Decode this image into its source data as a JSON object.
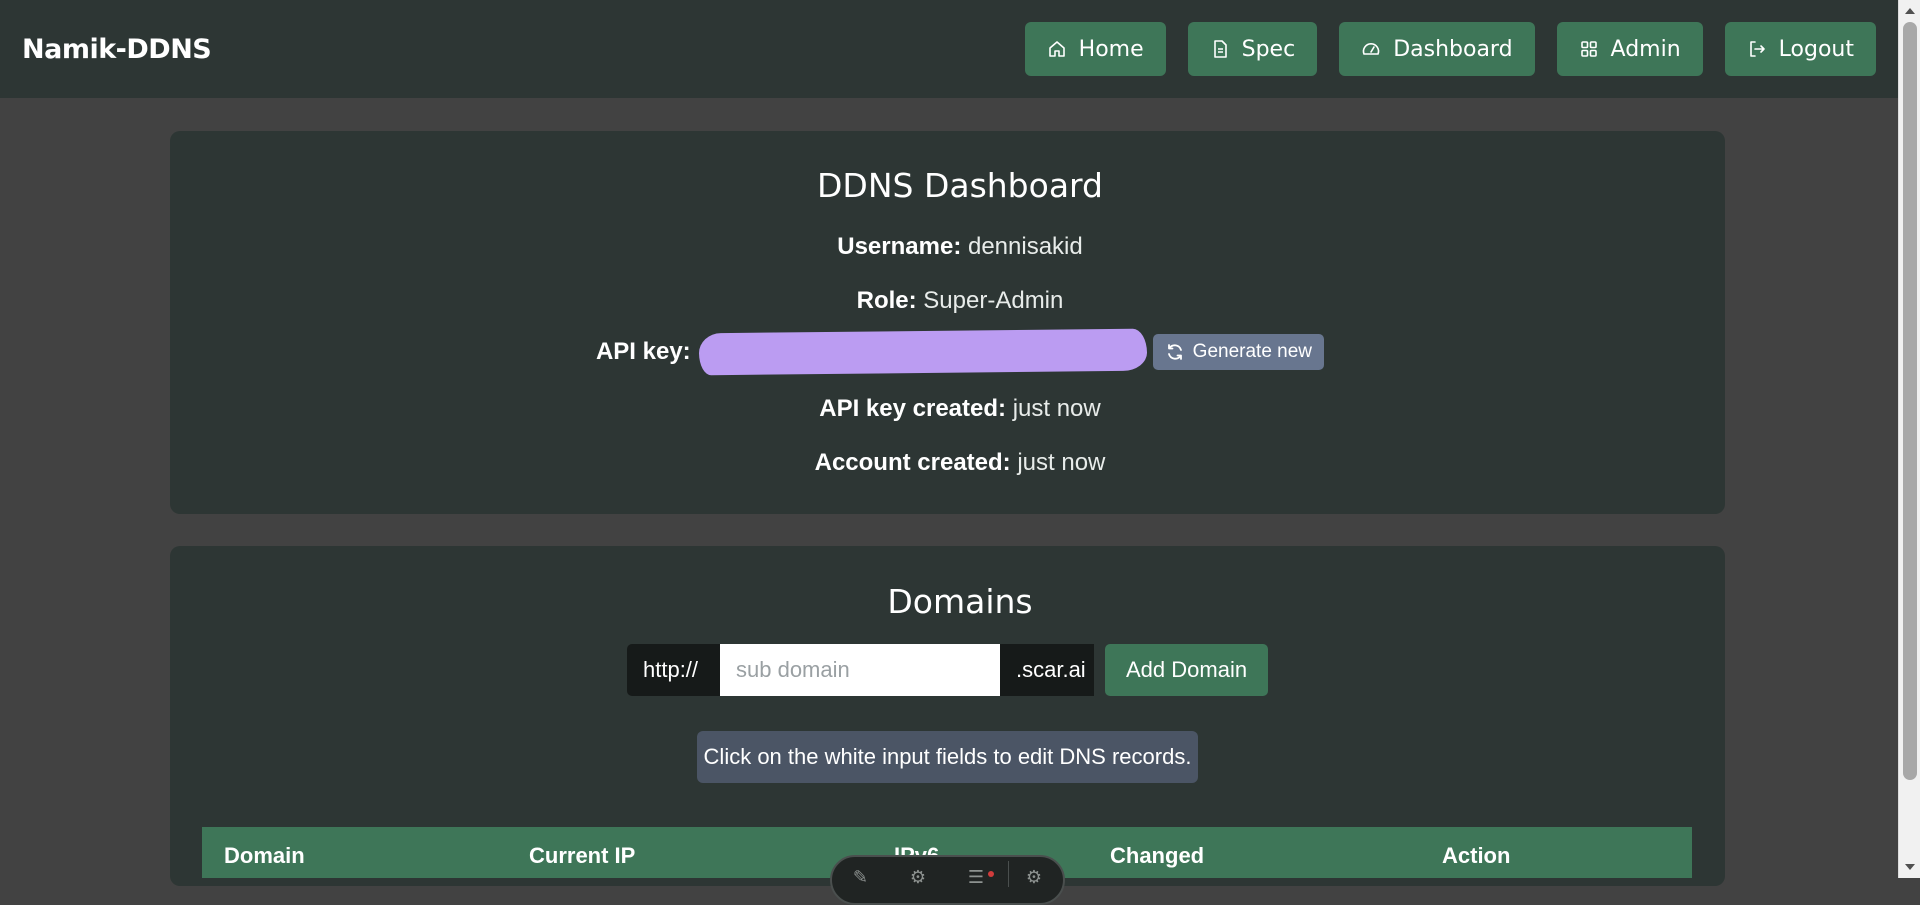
{
  "brand": "Namik-DDNS",
  "nav": {
    "home": "Home",
    "spec": "Spec",
    "dashboard": "Dashboard",
    "admin": "Admin",
    "logout": "Logout"
  },
  "dashboard": {
    "title": "DDNS Dashboard",
    "username_label": "Username:",
    "username_value": "dennisakid",
    "role_label": "Role:",
    "role_value": "Super-Admin",
    "api_key_label": "API key:",
    "generate_label": "Generate new",
    "api_created_label": "API key created:",
    "api_created_value": "just now",
    "account_created_label": "Account created:",
    "account_created_value": "just now"
  },
  "domains": {
    "title": "Domains",
    "prefix": "http://",
    "placeholder": "sub domain",
    "suffix": ".scar.ai",
    "add_label": "Add Domain",
    "hint": "Click on the white input fields to edit DNS records."
  },
  "table": {
    "columns": [
      "Domain",
      "Current IP",
      "IPv6",
      "Changed",
      "Action"
    ]
  },
  "colors": {
    "accent_green": "#3e7658",
    "card_bg": "#2d3634",
    "page_bg": "#424242",
    "redaction": "#bb9cf2"
  }
}
